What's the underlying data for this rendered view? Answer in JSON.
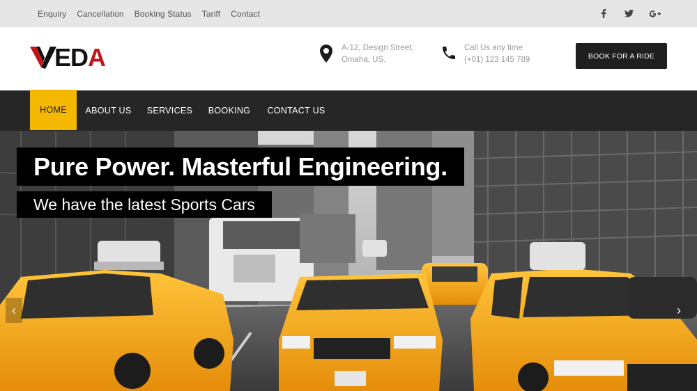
{
  "topbar": {
    "links": [
      "Enquiry",
      "Cancellation",
      "Booking Status",
      "Tariff",
      "Contact"
    ],
    "social_icons": [
      "facebook-icon",
      "twitter-icon",
      "google-plus-icon"
    ]
  },
  "header": {
    "logo_text": "VEDA",
    "address_line1": "A-12, Design Street,",
    "address_line2": "Omaha, US.",
    "call_line1": "Call Us any time",
    "call_line2": "(+01) 123 145 789",
    "book_button": "BOOK FOR A RIDE"
  },
  "nav": {
    "items": [
      "HOME",
      "ABOUT US",
      "SERVICES",
      "BOOKING",
      "CONTACT US"
    ],
    "active": "HOME"
  },
  "hero": {
    "headline": "Pure Power. Masterful Engineering.",
    "subheadline": "We have the latest Sports Cars",
    "prev_arrow": "‹",
    "next_arrow": "›"
  },
  "colors": {
    "accent": "#f5b800",
    "nav_bg": "#262626",
    "topbar_bg": "#e6e6e6",
    "brand_red": "#c3161b",
    "taxi_yellow": "#f3a51a"
  }
}
